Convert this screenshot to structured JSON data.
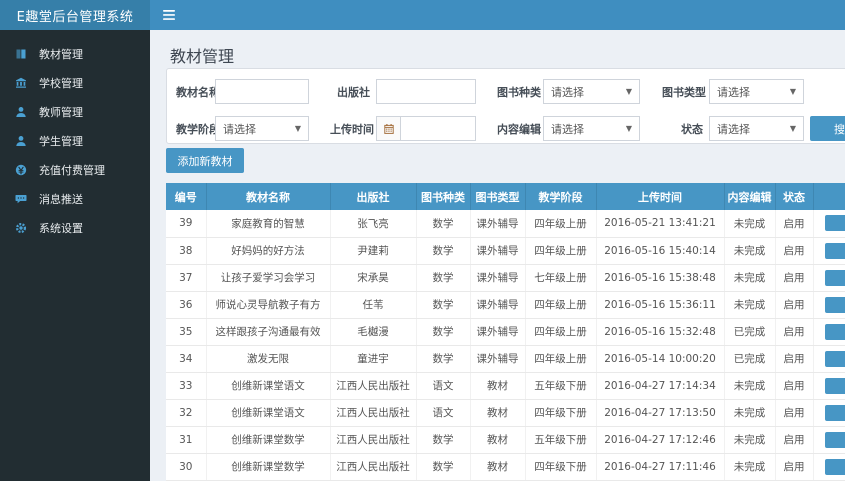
{
  "topbar": {
    "title": "E趣堂后台管理系统"
  },
  "sidebar": {
    "items": [
      {
        "label": "教材管理",
        "icon": "book-icon"
      },
      {
        "label": "学校管理",
        "icon": "school-icon"
      },
      {
        "label": "教师管理",
        "icon": "teacher-icon"
      },
      {
        "label": "学生管理",
        "icon": "student-icon"
      },
      {
        "label": "充值付费管理",
        "icon": "payment-icon"
      },
      {
        "label": "消息推送",
        "icon": "message-icon"
      },
      {
        "label": "系统设置",
        "icon": "gear-icon"
      }
    ]
  },
  "page": {
    "title": "教材管理"
  },
  "filters": {
    "rows": [
      [
        {
          "label": "教材名称",
          "type": "text",
          "value": ""
        },
        {
          "label": "出版社",
          "type": "text",
          "value": ""
        },
        {
          "label": "图书种类",
          "type": "select",
          "value": "请选择"
        },
        {
          "label": "图书类型",
          "type": "select",
          "value": "请选择"
        }
      ],
      [
        {
          "label": "教学阶段",
          "type": "select",
          "value": "请选择"
        },
        {
          "label": "上传时间",
          "type": "date",
          "value": ""
        },
        {
          "label": "内容编辑",
          "type": "select",
          "value": "请选择"
        },
        {
          "label": "状态",
          "type": "select",
          "value": "请选择"
        }
      ]
    ],
    "search_label": "搜索"
  },
  "toolbar": {
    "add_label": "添加新教材"
  },
  "table": {
    "headers": [
      "编号",
      "教材名称",
      "出版社",
      "图书种类",
      "图书类型",
      "教学阶段",
      "上传时间",
      "内容编辑",
      "状态",
      ""
    ],
    "rows": [
      [
        "39",
        "家庭教育的智慧",
        "张飞亮",
        "数学",
        "课外辅导",
        "四年级上册",
        "2016-05-21 13:41:21",
        "未完成",
        "启用"
      ],
      [
        "38",
        "好妈妈的好方法",
        "尹建莉",
        "数学",
        "课外辅导",
        "四年级上册",
        "2016-05-16 15:40:14",
        "未完成",
        "启用"
      ],
      [
        "37",
        "让孩子爱学习会学习",
        "宋承昊",
        "数学",
        "课外辅导",
        "七年级上册",
        "2016-05-16 15:38:48",
        "未完成",
        "启用"
      ],
      [
        "36",
        "师说心灵导航教子有方",
        "任苇",
        "数学",
        "课外辅导",
        "四年级上册",
        "2016-05-16 15:36:11",
        "未完成",
        "启用"
      ],
      [
        "35",
        "这样跟孩子沟通最有效",
        "毛樾漫",
        "数学",
        "课外辅导",
        "四年级上册",
        "2016-05-16 15:32:48",
        "已完成",
        "启用"
      ],
      [
        "34",
        "激发无限",
        "童进宇",
        "数学",
        "课外辅导",
        "四年级上册",
        "2016-05-14 10:00:20",
        "已完成",
        "启用"
      ],
      [
        "33",
        "创维新课堂语文",
        "江西人民出版社",
        "语文",
        "教材",
        "五年级下册",
        "2016-04-27 17:14:34",
        "未完成",
        "启用"
      ],
      [
        "32",
        "创维新课堂语文",
        "江西人民出版社",
        "语文",
        "教材",
        "四年级下册",
        "2016-04-27 17:13:50",
        "未完成",
        "启用"
      ],
      [
        "31",
        "创维新课堂数学",
        "江西人民出版社",
        "数学",
        "教材",
        "五年级下册",
        "2016-04-27 17:12:46",
        "未完成",
        "启用"
      ],
      [
        "30",
        "创维新课堂数学",
        "江西人民出版社",
        "数学",
        "教材",
        "四年级下册",
        "2016-04-27 17:11:46",
        "未完成",
        "启用"
      ]
    ]
  },
  "colors": {
    "accent": "#4796c5",
    "navbar": "#3f8ec0",
    "logo_bg": "#367fa9",
    "sidebar_bg": "#222d32",
    "sidebar_icon": "#4aa0d2",
    "table_header": "#4796c5"
  }
}
